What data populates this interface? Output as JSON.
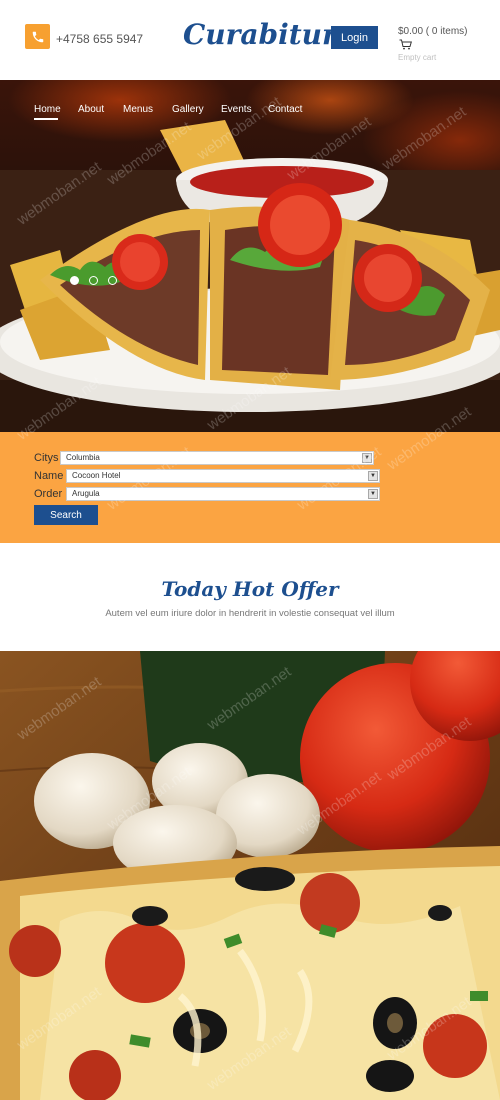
{
  "header": {
    "phone": "+4758 655 5947",
    "logo": "Curabitur",
    "login_label": "Login",
    "cart_total": "$0.00 ( 0 items)",
    "cart_status": "Empty cart"
  },
  "nav": {
    "items": [
      {
        "label": "Home",
        "active": true
      },
      {
        "label": "About"
      },
      {
        "label": "Menus"
      },
      {
        "label": "Gallery"
      },
      {
        "label": "Events"
      },
      {
        "label": "Contact"
      }
    ]
  },
  "slider": {
    "slide_count": 3,
    "active_slide": 1
  },
  "search": {
    "fields": [
      {
        "label": "Citys",
        "value": "Columbia"
      },
      {
        "label": "Name",
        "value": "Cocoon Hotel"
      },
      {
        "label": "Order",
        "value": "Arugula"
      }
    ],
    "button_label": "Search"
  },
  "offer": {
    "title": "Today Hot Offer",
    "subtitle": "Autem vel eum iriure dolor in hendrerit in volestie consequat vel illum"
  },
  "watermark": "webmoban.net",
  "colors": {
    "brand_blue": "#1d4f8f",
    "accent_orange": "#fba442"
  },
  "icons": [
    "phone-icon",
    "cart-icon",
    "select-arrow-icon"
  ]
}
